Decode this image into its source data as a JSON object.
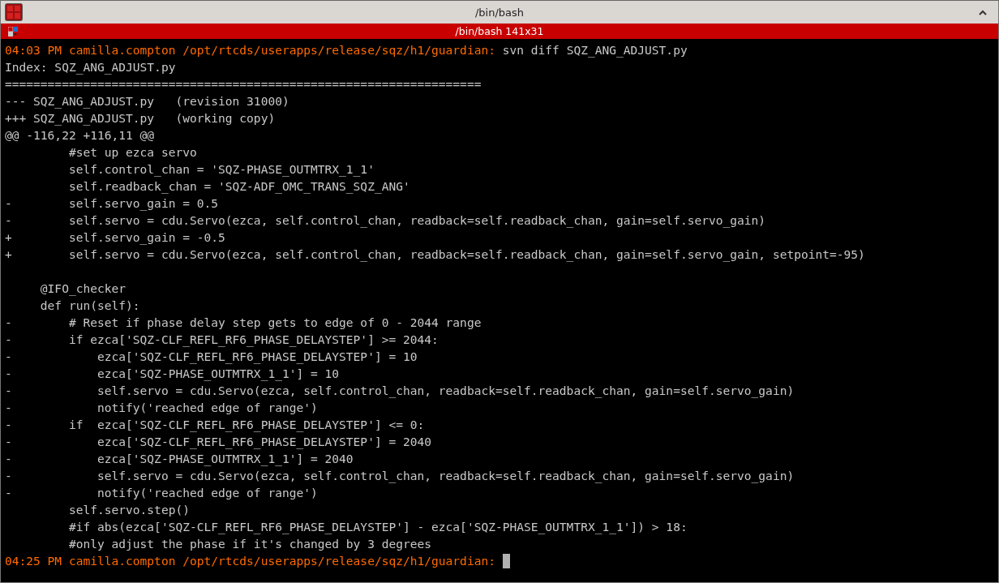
{
  "window": {
    "title": "/bin/bash"
  },
  "tab": {
    "title": "/bin/bash 141x31"
  },
  "terminal": {
    "lines": [
      {
        "kind": "prompt",
        "prompt": "04:03 PM camilla.compton /opt/rtcds/userapps/release/sqz/h1/guardian:",
        "command": "svn diff SQZ_ANG_ADJUST.py"
      },
      {
        "kind": "text",
        "text": "Index: SQZ_ANG_ADJUST.py"
      },
      {
        "kind": "text",
        "text": "==================================================================="
      },
      {
        "kind": "text",
        "text": "--- SQZ_ANG_ADJUST.py\t(revision 31000)"
      },
      {
        "kind": "text",
        "text": "+++ SQZ_ANG_ADJUST.py\t(working copy)"
      },
      {
        "kind": "text",
        "text": "@@ -116,22 +116,11 @@"
      },
      {
        "kind": "text",
        "text": "         #set up ezca servo"
      },
      {
        "kind": "text",
        "text": "         self.control_chan = 'SQZ-PHASE_OUTMTRX_1_1'"
      },
      {
        "kind": "text",
        "text": "         self.readback_chan = 'SQZ-ADF_OMC_TRANS_SQZ_ANG'"
      },
      {
        "kind": "text",
        "text": "-        self.servo_gain = 0.5"
      },
      {
        "kind": "text",
        "text": "-        self.servo = cdu.Servo(ezca, self.control_chan, readback=self.readback_chan, gain=self.servo_gain)"
      },
      {
        "kind": "text",
        "text": "+        self.servo_gain = -0.5"
      },
      {
        "kind": "text",
        "text": "+        self.servo = cdu.Servo(ezca, self.control_chan, readback=self.readback_chan, gain=self.servo_gain, setpoint=-95)"
      },
      {
        "kind": "blank"
      },
      {
        "kind": "text",
        "text": "     @IFO_checker"
      },
      {
        "kind": "text",
        "text": "     def run(self):"
      },
      {
        "kind": "text",
        "text": "-        # Reset if phase delay step gets to edge of 0 - 2044 range"
      },
      {
        "kind": "text",
        "text": "-        if ezca['SQZ-CLF_REFL_RF6_PHASE_DELAYSTEP'] >= 2044:"
      },
      {
        "kind": "text",
        "text": "-            ezca['SQZ-CLF_REFL_RF6_PHASE_DELAYSTEP'] = 10"
      },
      {
        "kind": "text",
        "text": "-            ezca['SQZ-PHASE_OUTMTRX_1_1'] = 10"
      },
      {
        "kind": "text",
        "text": "-            self.servo = cdu.Servo(ezca, self.control_chan, readback=self.readback_chan, gain=self.servo_gain)"
      },
      {
        "kind": "text",
        "text": "-            notify('reached edge of range')"
      },
      {
        "kind": "text",
        "text": "-        if  ezca['SQZ-CLF_REFL_RF6_PHASE_DELAYSTEP'] <= 0:"
      },
      {
        "kind": "text",
        "text": "-            ezca['SQZ-CLF_REFL_RF6_PHASE_DELAYSTEP'] = 2040"
      },
      {
        "kind": "text",
        "text": "-            ezca['SQZ-PHASE_OUTMTRX_1_1'] = 2040"
      },
      {
        "kind": "text",
        "text": "-            self.servo = cdu.Servo(ezca, self.control_chan, readback=self.readback_chan, gain=self.servo_gain)"
      },
      {
        "kind": "text",
        "text": "-            notify('reached edge of range')"
      },
      {
        "kind": "text",
        "text": "         self.servo.step()"
      },
      {
        "kind": "text",
        "text": "         #if abs(ezca['SQZ-CLF_REFL_RF6_PHASE_DELAYSTEP'] - ezca['SQZ-PHASE_OUTMTRX_1_1']) > 18:"
      },
      {
        "kind": "text",
        "text": "         #only adjust the phase if it's changed by 3 degrees"
      },
      {
        "kind": "prompt",
        "prompt": "04:25 PM camilla.compton /opt/rtcds/userapps/release/sqz/h1/guardian:",
        "cursor": true
      }
    ]
  }
}
